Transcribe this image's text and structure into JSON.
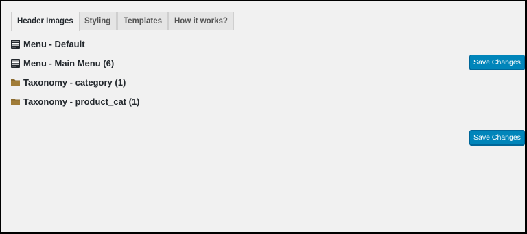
{
  "tabs": [
    {
      "label": "Header Images",
      "active": true
    },
    {
      "label": "Styling",
      "active": false
    },
    {
      "label": "Templates",
      "active": false
    },
    {
      "label": "How it works?",
      "active": false
    }
  ],
  "items": [
    {
      "label": "Menu - Default",
      "icon": "menu-icon"
    },
    {
      "label": "Menu - Main Menu (6)",
      "icon": "menu-icon"
    },
    {
      "label": "Taxonomy - category (1)",
      "icon": "folder-icon"
    },
    {
      "label": "Taxonomy - product_cat (1)",
      "icon": "folder-icon"
    }
  ],
  "buttons": {
    "save_top": "Save Changes",
    "save_bottom": "Save Changes"
  },
  "colors": {
    "primary_button": "#0085ba",
    "folder": "#8a6a2e",
    "background": "#f1f1f1"
  }
}
